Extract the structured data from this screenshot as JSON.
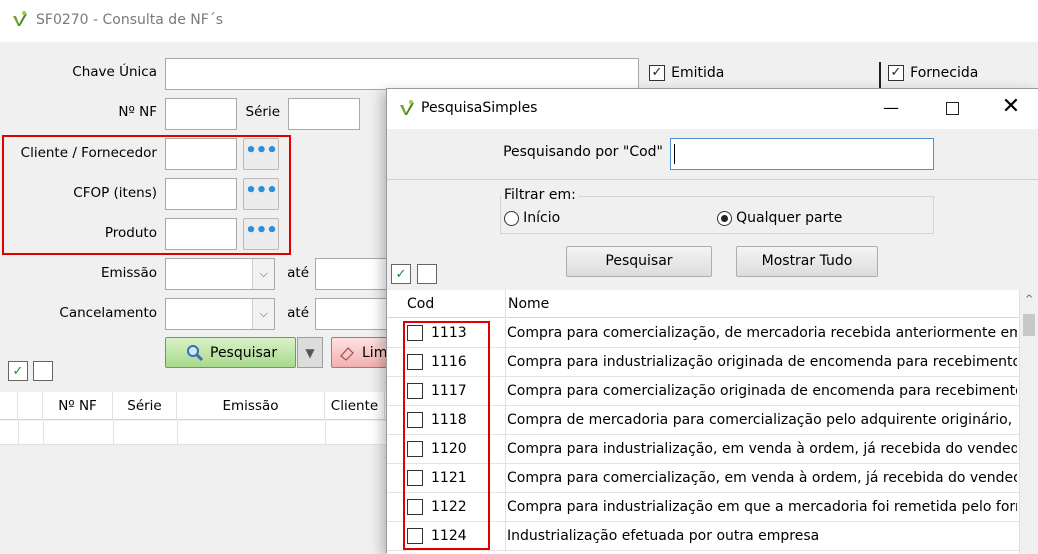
{
  "main_window": {
    "title": "SF0270 - Consulta de NF´s",
    "fields": {
      "chave_unica_label": "Chave Única",
      "nf_label": "Nº NF",
      "serie_label": "Série",
      "cliente_fornecedor_label": "Cliente / Fornecedor",
      "cfop_label": "CFOP (itens)",
      "produto_label": "Produto",
      "emissao_label": "Emissão",
      "cancelamento_label": "Cancelamento",
      "ate_label": "até"
    },
    "checkboxes": {
      "emitida_label": "Emitida",
      "fornecida_label": "Fornecida"
    },
    "buttons": {
      "pesquisar_label": "Pesquisar",
      "limpar_label": "Lim"
    },
    "grid_columns": [
      "Nº NF",
      "Série",
      "Emissão",
      "Cliente"
    ]
  },
  "dialog": {
    "title": "PesquisaSimples",
    "search_label": "Pesquisando por \"Cod\"",
    "search_value": "",
    "filter_label": "Filtrar em:",
    "filter_options": [
      "Início",
      "Qualquer parte"
    ],
    "filter_selected": "Qualquer parte",
    "pesquisar_label": "Pesquisar",
    "mostrar_tudo_label": "Mostrar Tudo",
    "columns": {
      "cod": "Cod",
      "nome": "Nome"
    },
    "rows": [
      {
        "cod": "1113",
        "nome": "Compra para comercialização, de mercadoria recebida anteriormente em"
      },
      {
        "cod": "1116",
        "nome": "Compra para industrialização originada de encomenda para recebimento f"
      },
      {
        "cod": "1117",
        "nome": "Compra para comercialização originada de encomenda para recebimento"
      },
      {
        "cod": "1118",
        "nome": "Compra de mercadoria para comercialização pelo adquirente originário, e"
      },
      {
        "cod": "1120",
        "nome": "Compra para industrialização, em venda à ordem, já recebida do vendedo"
      },
      {
        "cod": "1121",
        "nome": "Compra para comercialização, em venda à ordem, já recebida do vendedo"
      },
      {
        "cod": "1122",
        "nome": "Compra para industrialização em que a mercadoria foi remetida pelo forne"
      },
      {
        "cod": "1124",
        "nome": "Industrialização efetuada por outra empresa"
      }
    ]
  },
  "colors": {
    "highlight_red": "#e00000",
    "accent_green": "#4caf50",
    "ellipsis_blue": "#2a8fd8"
  }
}
